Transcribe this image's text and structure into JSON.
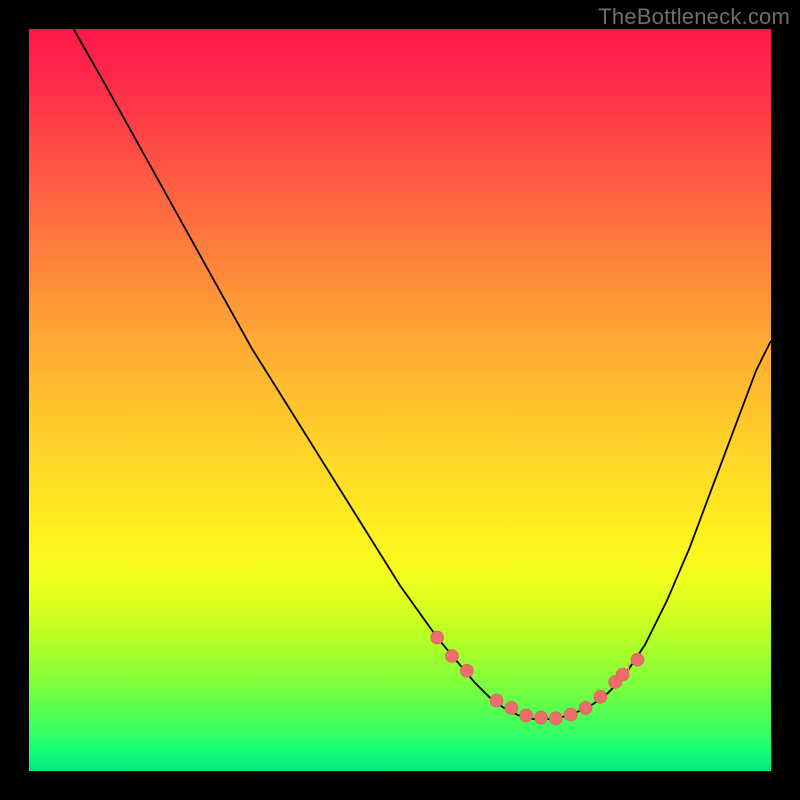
{
  "watermark": "TheBottleneck.com",
  "chart_data": {
    "type": "line",
    "title": "",
    "xlabel": "",
    "ylabel": "",
    "xlim": [
      0,
      100
    ],
    "ylim": [
      0,
      100
    ],
    "series": [
      {
        "name": "curve",
        "x": [
          6,
          10,
          15,
          20,
          25,
          30,
          35,
          40,
          45,
          50,
          55,
          60,
          62,
          64,
          66,
          68,
          70,
          72,
          74,
          76,
          78,
          80,
          83,
          86,
          89,
          92,
          95,
          98,
          100
        ],
        "y": [
          100,
          93,
          84,
          75,
          66,
          57,
          49,
          41,
          33,
          25,
          18,
          12,
          10,
          8.5,
          7.5,
          7,
          7,
          7.3,
          8,
          9,
          10.5,
          12.5,
          17,
          23,
          30,
          38,
          46,
          54,
          58
        ]
      }
    ],
    "markers": {
      "name": "dots",
      "x": [
        55,
        57,
        59,
        63,
        65,
        67,
        69,
        71,
        73,
        75,
        77,
        79,
        80,
        82
      ],
      "y": [
        18,
        15.5,
        13.5,
        9.5,
        8.5,
        7.5,
        7.2,
        7.1,
        7.6,
        8.5,
        10,
        12,
        13,
        15
      ]
    },
    "small_hashes": {
      "x": [
        79.5,
        80.2,
        80.8
      ],
      "y": [
        12.2,
        13,
        13.8
      ]
    },
    "colors": {
      "curve": "#000000",
      "dot_fill": "#ec6d6b",
      "dot_stroke": "#df5757",
      "hash": "#e8a24f",
      "gradient_top": "#ff1748",
      "gradient_mid": "#ffd728",
      "gradient_bottom": "#00e87f",
      "background": "#000000",
      "watermark": "#6e6e6e"
    }
  }
}
